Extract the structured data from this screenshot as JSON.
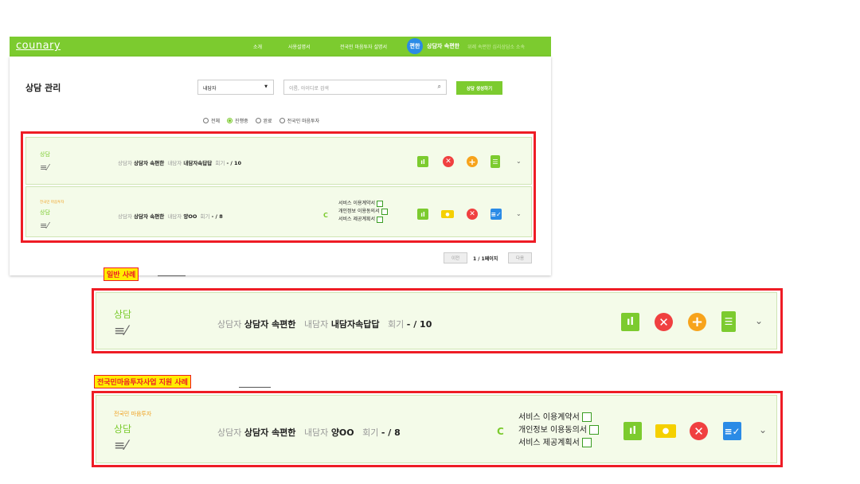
{
  "topbar": {
    "logo": "counary",
    "nav": [
      "소개",
      "사용설명서",
      "전국민 마음투자 설명서"
    ],
    "user_badge": "편한",
    "user_name": "상담자 속편한",
    "affiliation": "위례 속편한 심리상담소 소속"
  },
  "page": {
    "title": "상담 관리",
    "filter_select": "내담자",
    "search_placeholder": "이름, 아이디로 검색",
    "create_button": "상담 생성하기",
    "radios": [
      "전체",
      "진행중",
      "완료",
      "전국민 마음투자"
    ],
    "radio_selected": "진행중"
  },
  "rows": [
    {
      "tag": "",
      "type": "상담",
      "counselor_label": "상담자",
      "counselor": "상담자 속편한",
      "client_label": "내담자",
      "client": "내담자속답답",
      "session_label": "회기",
      "session": "- / 10"
    },
    {
      "tag": "전국민 마음투자",
      "type": "상담",
      "counselor_label": "상담자",
      "counselor": "상담자 속편한",
      "client_label": "내담자",
      "client": "양OO",
      "session_label": "회기",
      "session": "- / 8",
      "documents": [
        "서비스 이용계약서",
        "개인정보 이용동의서",
        "서비스 제공계획서"
      ]
    }
  ],
  "pagination": {
    "prev": "이전",
    "status": "1 / 1페이지",
    "next": "다음"
  },
  "callouts": {
    "general": "일반 사례",
    "national": "전국민마음투자사업 지원 사례"
  },
  "colors": {
    "brand_green": "#7ccb2f",
    "highlight_red": "#ee1c25",
    "label_yellow": "#ffed00",
    "row_bg": "#f4fbe9"
  },
  "icons": [
    "stats-icon",
    "close-icon",
    "plus-icon",
    "clipboard-icon",
    "money-icon",
    "checklist-icon",
    "refresh-icon",
    "chevron-down-icon",
    "edit-note-icon"
  ]
}
